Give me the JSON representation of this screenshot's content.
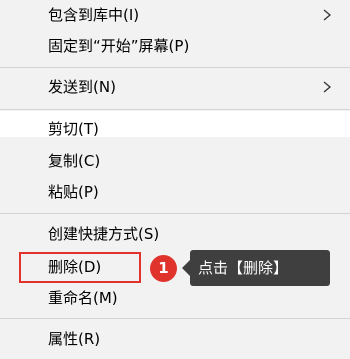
{
  "menu": {
    "items": [
      {
        "label": "包含到库中(I)",
        "has_submenu": true
      },
      {
        "label": "固定到“开始”屏幕(P)",
        "has_submenu": false
      },
      {
        "label": "发送到(N)",
        "has_submenu": true
      },
      {
        "label": "剪切(T)",
        "has_submenu": false
      },
      {
        "label": "复制(C)",
        "has_submenu": false
      },
      {
        "label": "粘贴(P)",
        "has_submenu": false
      },
      {
        "label": "创建快捷方式(S)",
        "has_submenu": false
      },
      {
        "label": "删除(D)",
        "has_submenu": false
      },
      {
        "label": "重命名(M)",
        "has_submenu": false
      },
      {
        "label": "属性(R)",
        "has_submenu": false
      }
    ]
  },
  "annotation": {
    "step_number": "1",
    "tooltip_text": "点击【删除】",
    "color": "#e0332c"
  }
}
